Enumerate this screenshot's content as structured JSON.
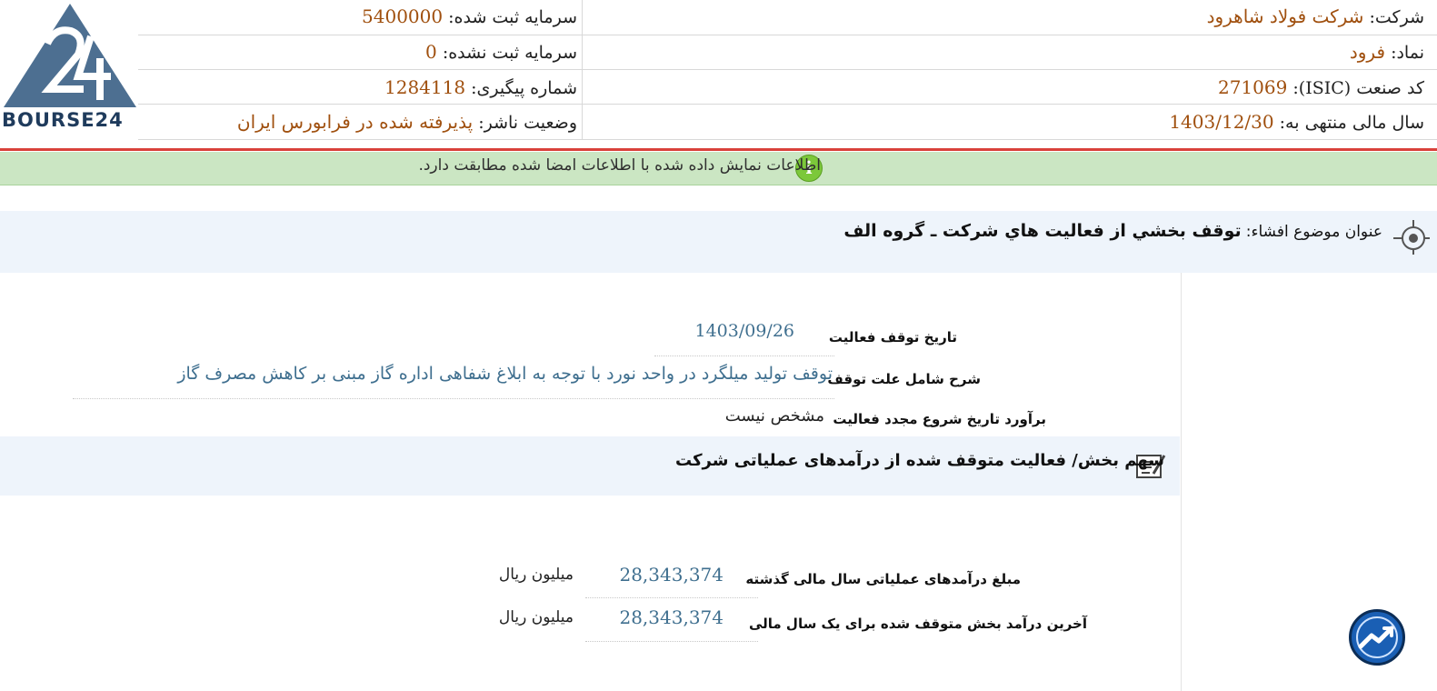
{
  "logo": {
    "text": "BOURSE24"
  },
  "header": {
    "company_label": "شرکت:",
    "company_value": "شرکت فولاد شاهرود",
    "symbol_label": "نماد:",
    "symbol_value": "فرود",
    "isic_label": "کد صنعت (ISIC):",
    "isic_value": "271069",
    "fiscal_label": "سال مالی منتهی به:",
    "fiscal_value": "1403/12/30",
    "reg_capital_label": "سرمایه ثبت شده:",
    "reg_capital_value": "5400000",
    "unreg_capital_label": "سرمایه ثبت نشده:",
    "unreg_capital_value": "0",
    "tracking_label": "شماره پیگیری:",
    "tracking_value": "1284118",
    "publisher_status_label": "وضعیت ناشر:",
    "publisher_status_value": "پذیرفته شده در فرابورس ایران"
  },
  "banner": {
    "text": "اطلاعات نمایش داده شده با اطلاعات امضا شده مطابقت دارد."
  },
  "subject": {
    "label": "عنوان موضوع افشاء:",
    "value": "توقف بخشي از فعاليت هاي شرکت ـ گروه الف"
  },
  "fields": {
    "stop_date_label": "تاریخ توقف فعالیت",
    "stop_date_value": "1403/09/26",
    "reason_label": "شرح شامل علت توقف",
    "reason_value": "توقف تولید میلگرد در واحد نورد با توجه به ابلاغ شفاهی اداره گاز مبنی بر کاهش مصرف گاز",
    "restart_label": "برآورد تاریخ شروع مجدد فعالیت",
    "restart_value": "مشخص نیست"
  },
  "section": {
    "title": "سهم بخش/ فعالیت متوقف شده از درآمدهای عملیاتی شرکت",
    "rows": [
      {
        "label": "مبلغ درآمدهای عملیاتی سال مالی گذشته",
        "value": "28,343,374",
        "unit": "میلیون ریال"
      },
      {
        "label": "آخرین درآمد بخش متوقف شده برای یک سال مالی",
        "value": "28,343,374",
        "unit": "میلیون ریال"
      }
    ]
  },
  "colors": {
    "accent_value": "#a0500f",
    "field_value": "#3f6f8f",
    "banner_bg": "#cbe6c3",
    "red_line": "#d9413a"
  },
  "icons": [
    "logo-triangle-icon",
    "info-icon",
    "target-icon",
    "edit-note-icon",
    "chart-trend-icon"
  ]
}
